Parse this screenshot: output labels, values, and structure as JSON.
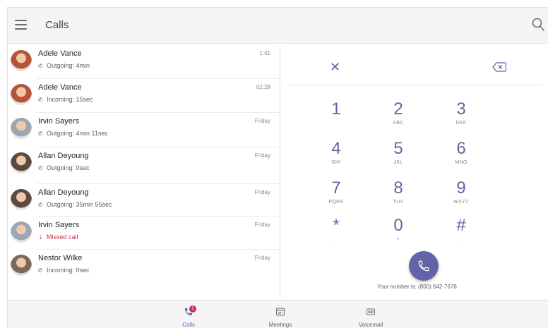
{
  "header": {
    "title": "Calls"
  },
  "calls": [
    {
      "name": "Adele Vance",
      "direction": "Outgoing",
      "detail": "Outgoing: 4min",
      "time": "1:41",
      "avatar_color": "#b5543a"
    },
    {
      "name": "Adele Vance",
      "direction": "Incoming",
      "detail": "Incoming: 15sec",
      "time": "02:28",
      "avatar_color": "#b5543a"
    },
    {
      "name": "Irvin Sayers",
      "direction": "Outgoing",
      "detail": "Outgoing: 4min 11sec",
      "time": "Friday",
      "avatar_color": "#9aa7b4"
    },
    {
      "name": "Allan Deyoung",
      "direction": "Outgoing",
      "detail": "Outgoing: 0sec",
      "time": "Friday",
      "avatar_color": "#5b4a3f"
    },
    {
      "name": "Allan Deyoung",
      "direction": "Outgoing",
      "detail": "Outgoing: 35min 55sec",
      "time": "Friday",
      "avatar_color": "#5b4a3f"
    },
    {
      "name": "Irvin Sayers",
      "direction": "Missed",
      "detail": "Missed call",
      "time": "Friday",
      "avatar_color": "#9aa7b4"
    },
    {
      "name": "Nestor Wilke",
      "direction": "Incoming",
      "detail": "Incoming: 0sec",
      "time": "Friday",
      "avatar_color": "#7a6a5e"
    }
  ],
  "dialpad": {
    "keys": [
      {
        "digit": "1",
        "letters": ""
      },
      {
        "digit": "2",
        "letters": "ABC"
      },
      {
        "digit": "3",
        "letters": "DEF"
      },
      {
        "digit": "4",
        "letters": "GHI"
      },
      {
        "digit": "5",
        "letters": "JKL"
      },
      {
        "digit": "6",
        "letters": "MNO"
      },
      {
        "digit": "7",
        "letters": "PQRS"
      },
      {
        "digit": "8",
        "letters": "TUV"
      },
      {
        "digit": "9",
        "letters": "WXYZ"
      },
      {
        "digit": "*",
        "letters": "."
      },
      {
        "digit": "0",
        "letters": "+"
      },
      {
        "digit": "#",
        "letters": "."
      }
    ],
    "your_number": "Your number is: (800) 642-7676"
  },
  "nav": {
    "calls_label": "Calls",
    "calls_badge": "1",
    "meetings_label": "Meetings",
    "voicemail_label": "Voicemail"
  },
  "colors": {
    "accent": "#6264a7",
    "missed": "#c4314b"
  },
  "icons": {
    "menu": "hamburger-menu-icon",
    "search": "search-icon",
    "clear": "close-icon",
    "backspace": "backspace-icon",
    "call": "phone-icon",
    "outgoing": "outgoing-call-icon",
    "incoming": "incoming-call-icon",
    "missed": "missed-call-icon",
    "meetings": "calendar-icon",
    "voicemail": "voicemail-icon"
  }
}
